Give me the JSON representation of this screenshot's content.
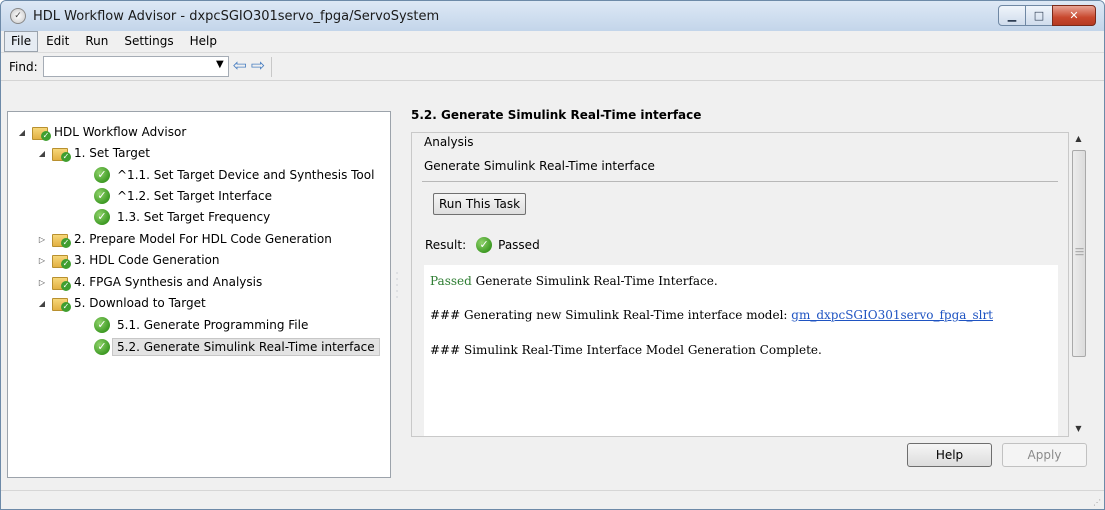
{
  "window": {
    "title": "HDL Workflow Advisor - dxpcSGIO301servo_fpga/ServoSystem"
  },
  "menu": [
    {
      "label": "File"
    },
    {
      "label": "Edit"
    },
    {
      "label": "Run"
    },
    {
      "label": "Settings"
    },
    {
      "label": "Help"
    }
  ],
  "toolbar": {
    "find_label": "Find:",
    "find_value": ""
  },
  "tree": [
    {
      "label": "HDL Workflow Advisor",
      "level": 0,
      "icon": "folder-check-icon",
      "expander": "expanded"
    },
    {
      "label": "1. Set Target",
      "level": 1,
      "icon": "folder-check-icon",
      "expander": "expanded"
    },
    {
      "label": "^1.1. Set Target Device and Synthesis Tool",
      "level": 2,
      "icon": "check-icon",
      "expander": "none"
    },
    {
      "label": "^1.2. Set Target Interface",
      "level": 2,
      "icon": "check-icon",
      "expander": "none"
    },
    {
      "label": "1.3. Set Target Frequency",
      "level": 2,
      "icon": "check-icon",
      "expander": "none"
    },
    {
      "label": "2. Prepare Model For HDL Code Generation",
      "level": 1,
      "icon": "folder-check-icon",
      "expander": "collapsed"
    },
    {
      "label": "3. HDL Code Generation",
      "level": 1,
      "icon": "folder-check-icon",
      "expander": "collapsed"
    },
    {
      "label": "4. FPGA Synthesis and Analysis",
      "level": 1,
      "icon": "folder-check-icon",
      "expander": "collapsed"
    },
    {
      "label": "5. Download to Target",
      "level": 1,
      "icon": "folder-check-icon",
      "expander": "expanded"
    },
    {
      "label": "5.1. Generate Programming File",
      "level": 2,
      "icon": "check-icon",
      "expander": "none"
    },
    {
      "label": "5.2. Generate Simulink Real-Time interface",
      "level": 2,
      "icon": "check-icon",
      "expander": "none",
      "selected": true
    }
  ],
  "task": {
    "title": "5.2. Generate Simulink Real-Time interface",
    "analysis_legend": "Analysis",
    "analysis_description": "Generate Simulink Real-Time interface",
    "run_button": "Run This Task",
    "result_label": "Result:",
    "result_value": "Passed"
  },
  "report": {
    "passed_word": "Passed",
    "passed_text": " Generate Simulink Real-Time Interface.",
    "line2_prefix": "### Generating new Simulink Real-Time interface model: ",
    "line2_link": "gm_dxpcSGIO301servo_fpga_slrt",
    "line3": "### Simulink Real-Time Interface Model Generation Complete."
  },
  "buttons": {
    "help": "Help",
    "apply": "Apply"
  },
  "colors": {
    "passed_green": "#2e7d32",
    "link_blue": "#1f54c2",
    "check_green": "#3e9a24"
  }
}
